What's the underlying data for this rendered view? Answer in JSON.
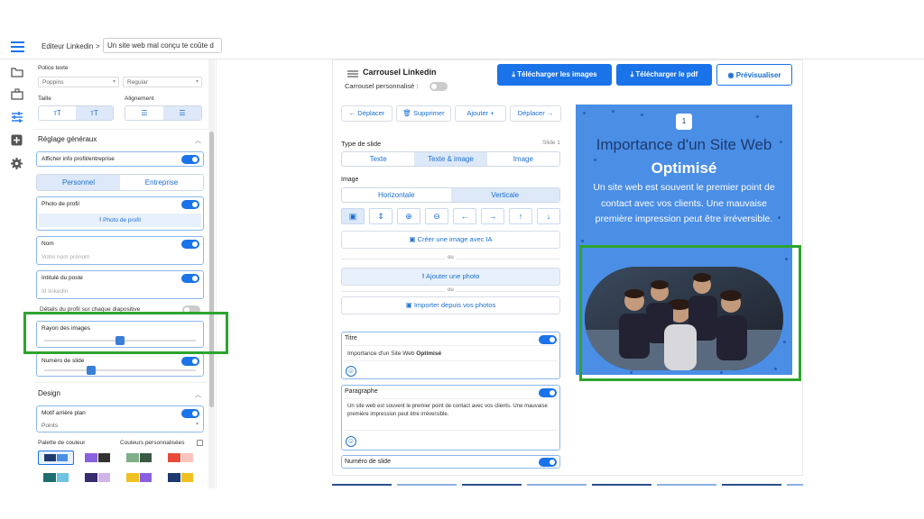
{
  "breadcrumb": {
    "root": "Editeur Linkedin",
    "sep": ">",
    "current": "Un site web mal conçu te coûte d"
  },
  "icons": [
    "menu-icon",
    "folder-icon",
    "briefcase-icon",
    "sliders-icon",
    "plus-square-icon",
    "gear-icon"
  ],
  "sidebar": {
    "police_texte": "Police texte",
    "font": "Poppins",
    "weight": "Regular",
    "taille": "Taille",
    "alignement": "Alignement",
    "reglage": "Réglage généraux",
    "afficher": "Afficher info profil/entreprise",
    "tab_personnel": "Personnel",
    "tab_entreprise": "Entreprise",
    "photo": "Photo de profil",
    "photo_btn": "Photo de profil",
    "nom": "Nom",
    "nom_ph": "Votre nom prénom",
    "poste": "Intitulé du poste",
    "poste_ph": "Id linkedin",
    "details": "Détails du profil sur chaque diapositive",
    "rayon": "Rayon des images",
    "rayon_value": 0.5,
    "numero": "Numéro de slide",
    "numero_value": 0.3,
    "design": "Design",
    "motif": "Motif arrière plan",
    "motif_value": "Points",
    "palette": "Palette de couleur",
    "custom": "Couleurs personnalisées",
    "palettes": [
      [
        "#1e3a6e",
        "#4a8ee6"
      ],
      [
        "#8a60e0",
        "#333"
      ],
      [
        "#7fae88",
        "#3a5a44"
      ],
      [
        "#e84a3a",
        "#fbc4bc"
      ],
      [
        "#1f6e6e",
        "#6ec4e0"
      ],
      [
        "#3a2a6e",
        "#d0b4e8"
      ],
      [
        "#f0c020",
        "#8a60e0"
      ],
      [
        "#1e3a6e",
        "#f0c020"
      ]
    ]
  },
  "main": {
    "title": "Carrousel Linkedin",
    "perso": "Carrousel personnalisé :",
    "dl_images": "Télécharger les images",
    "dl_pdf": "Télécharger le pdf",
    "preview": "Prévisualiser",
    "deplacer_l": "Déplacer",
    "supprimer": "Supprimer",
    "ajouter": "Ajouter",
    "deplacer_r": "Déplacer",
    "type_slide": "Type de slide",
    "slide_num": "Slide 1",
    "types": [
      "Texte",
      "Texte & image",
      "Image"
    ],
    "image": "Image",
    "orient": [
      "Horizontale",
      "Verticale"
    ],
    "creer_ia": "Créer une image avec IA",
    "ou1": "ou",
    "ajouter_photo": "Ajouter une photo",
    "ou2": "ou",
    "importer": "Importer depuis vos photos",
    "titre": "Titre",
    "titre_text_a": "Importance d'un Site Web ",
    "titre_text_b": "Optimisé",
    "paragraphe": "Paragraphe",
    "para_text": "Un site web est souvent le premier point de contact avec vos clients. Une mauvaise première impression peut être irréversible.",
    "numero": "Numéro de slide"
  },
  "slide": {
    "num": "1",
    "title_a": "Importance d'un Site Web ",
    "title_b": "Optimisé",
    "body": "Un site web est souvent le premier point de contact avec vos clients. Une mauvaise première impression peut être irréversible."
  },
  "colors": {
    "accent": "#1a73e8",
    "highlight": "#2ea42e",
    "slide_bg": "#4a8ee6",
    "slide_title": "#1e3a6e"
  }
}
